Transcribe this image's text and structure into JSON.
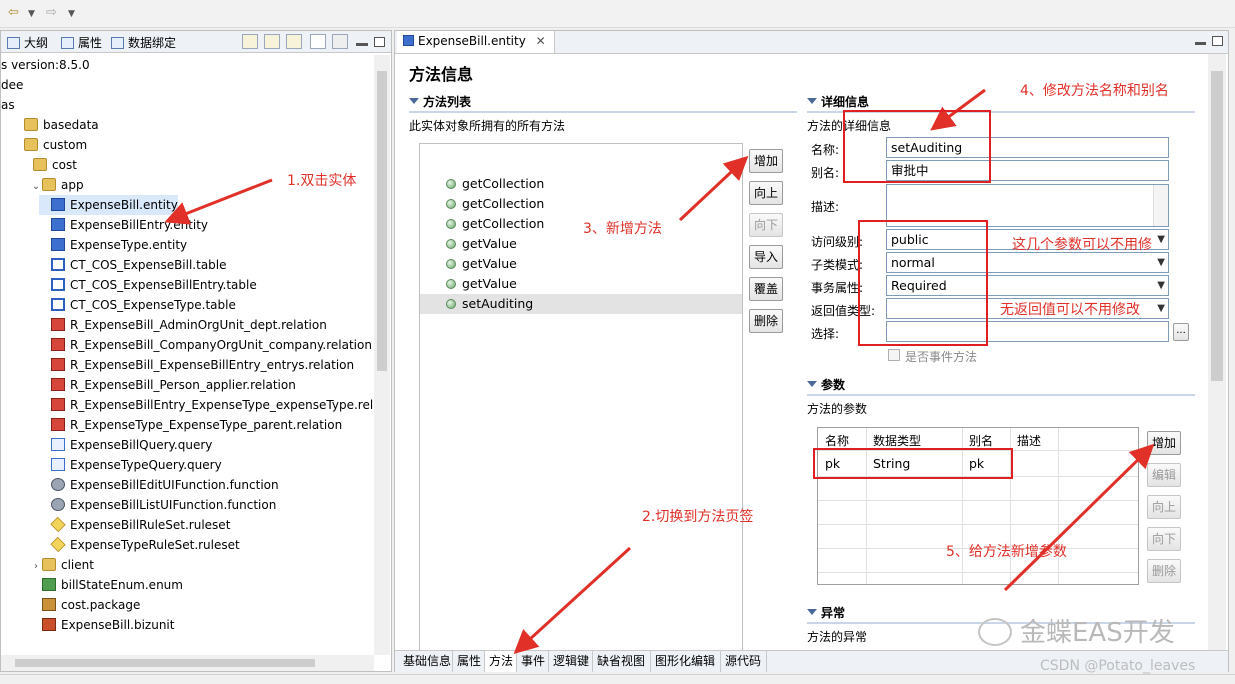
{
  "toolbar": {
    "back_icon": "back-arrow-icon",
    "forward_icon": "forward-arrow-icon"
  },
  "left_tabs": [
    {
      "label": "大纲",
      "icon": "outline-icon"
    },
    {
      "label": "属性",
      "icon": "properties-icon"
    },
    {
      "label": "数据绑定",
      "icon": "databind-icon"
    }
  ],
  "tree": [
    {
      "label": "s version:8.5.0",
      "indent": 0,
      "icon": "none",
      "twisty": ""
    },
    {
      "label": "dee",
      "indent": 0,
      "icon": "none",
      "twisty": ""
    },
    {
      "label": "as",
      "indent": 0,
      "icon": "none",
      "twisty": ""
    },
    {
      "label": "basedata",
      "indent": 1,
      "icon": "folder",
      "twisty": ""
    },
    {
      "label": "custom",
      "indent": 1,
      "icon": "folder",
      "twisty": ""
    },
    {
      "label": "cost",
      "indent": 2,
      "icon": "folder",
      "twisty": ""
    },
    {
      "label": "app",
      "indent": 3,
      "icon": "folder",
      "twisty": "v"
    },
    {
      "label": "ExpenseBill.entity",
      "indent": 4,
      "icon": "entity",
      "twisty": "",
      "selected": true
    },
    {
      "label": "ExpenseBillEntry.entity",
      "indent": 4,
      "icon": "entity",
      "twisty": ""
    },
    {
      "label": "ExpenseType.entity",
      "indent": 4,
      "icon": "entity",
      "twisty": ""
    },
    {
      "label": "CT_COS_ExpenseBill.table",
      "indent": 4,
      "icon": "table",
      "twisty": ""
    },
    {
      "label": "CT_COS_ExpenseBillEntry.table",
      "indent": 4,
      "icon": "table",
      "twisty": ""
    },
    {
      "label": "CT_COS_ExpenseType.table",
      "indent": 4,
      "icon": "table",
      "twisty": ""
    },
    {
      "label": "R_ExpenseBill_AdminOrgUnit_dept.relation",
      "indent": 4,
      "icon": "rel",
      "twisty": ""
    },
    {
      "label": "R_ExpenseBill_CompanyOrgUnit_company.relation",
      "indent": 4,
      "icon": "rel",
      "twisty": ""
    },
    {
      "label": "R_ExpenseBill_ExpenseBillEntry_entrys.relation",
      "indent": 4,
      "icon": "rel",
      "twisty": ""
    },
    {
      "label": "R_ExpenseBill_Person_applier.relation",
      "indent": 4,
      "icon": "rel",
      "twisty": ""
    },
    {
      "label": "R_ExpenseBillEntry_ExpenseType_expenseType.relatio",
      "indent": 4,
      "icon": "rel",
      "twisty": ""
    },
    {
      "label": "R_ExpenseType_ExpenseType_parent.relation",
      "indent": 4,
      "icon": "rel",
      "twisty": ""
    },
    {
      "label": "ExpenseBillQuery.query",
      "indent": 4,
      "icon": "query",
      "twisty": ""
    },
    {
      "label": "ExpenseTypeQuery.query",
      "indent": 4,
      "icon": "query",
      "twisty": ""
    },
    {
      "label": "ExpenseBillEditUIFunction.function",
      "indent": 4,
      "icon": "func",
      "twisty": ""
    },
    {
      "label": "ExpenseBillListUIFunction.function",
      "indent": 4,
      "icon": "func",
      "twisty": ""
    },
    {
      "label": "ExpenseBillRuleSet.ruleset",
      "indent": 4,
      "icon": "rule",
      "twisty": ""
    },
    {
      "label": "ExpenseTypeRuleSet.ruleset",
      "indent": 4,
      "icon": "rule",
      "twisty": ""
    },
    {
      "label": "client",
      "indent": 3,
      "icon": "folder",
      "twisty": ">"
    },
    {
      "label": "billStateEnum.enum",
      "indent": 3,
      "icon": "enum",
      "twisty": ""
    },
    {
      "label": "cost.package",
      "indent": 3,
      "icon": "pkg",
      "twisty": ""
    },
    {
      "label": "ExpenseBill.bizunit",
      "indent": 3,
      "icon": "biz",
      "twisty": ""
    }
  ],
  "editor": {
    "tab_title": "ExpenseBill.entity",
    "page_title": "方法信息",
    "method_list": {
      "heading": "方法列表",
      "description": "此实体对象所拥有的所有方法",
      "items": [
        "getCollection",
        "getCollection",
        "getCollection",
        "getValue",
        "getValue",
        "getValue",
        "setAuditing"
      ],
      "selected_index": 6,
      "buttons": [
        {
          "label": "增加",
          "enabled": true
        },
        {
          "label": "向上",
          "enabled": true
        },
        {
          "label": "向下",
          "enabled": false
        },
        {
          "label": "导入",
          "enabled": true
        },
        {
          "label": "覆盖",
          "enabled": true
        },
        {
          "label": "删除",
          "enabled": true
        }
      ]
    },
    "detail": {
      "heading": "详细信息",
      "description": "方法的详细信息",
      "name_label": "名称:",
      "name_value": "setAuditing",
      "alias_label": "别名:",
      "alias_value": "审批中",
      "desc_label": "描述:",
      "desc_value": "",
      "access_label": "访问级别:",
      "access_value": "public",
      "subclass_label": "子类模式:",
      "subclass_value": "normal",
      "tx_label": "事务属性:",
      "tx_value": "Required",
      "return_label": "返回值类型:",
      "return_value": "",
      "select_label": "选择:",
      "select_value": "",
      "event_checkbox_label": "是否事件方法",
      "browse_label": "..."
    },
    "params": {
      "heading": "参数",
      "description": "方法的参数",
      "columns": [
        "名称",
        "数据类型",
        "别名",
        "描述"
      ],
      "rows": [
        {
          "name": "pk",
          "type": "String",
          "alias": "pk",
          "desc": ""
        }
      ],
      "buttons": [
        {
          "label": "增加",
          "enabled": true
        },
        {
          "label": "编辑",
          "enabled": false
        },
        {
          "label": "向上",
          "enabled": false
        },
        {
          "label": "向下",
          "enabled": false
        },
        {
          "label": "删除",
          "enabled": false
        }
      ]
    },
    "exceptions": {
      "heading": "异常",
      "description": "方法的异常"
    },
    "bottom_tabs": [
      "基础信息",
      "属性",
      "方法",
      "事件",
      "逻辑键",
      "缺省视图",
      "图形化编辑",
      "源代码"
    ],
    "active_bottom_tab": "方法"
  },
  "annotations": {
    "step1": "1.双击实体",
    "step2": "2.切换到方法页签",
    "step3": "3、新增方法",
    "step4": "4、修改方法名称和别名",
    "step5": "5、给方法新增参数",
    "note_params": "这几个参数可以不用修",
    "note_return": "无返回值可以不用修改",
    "color": "#e03028"
  },
  "watermark": {
    "text": "金蝶EAS开发",
    "csdn": "CSDN @Potato_leaves"
  }
}
